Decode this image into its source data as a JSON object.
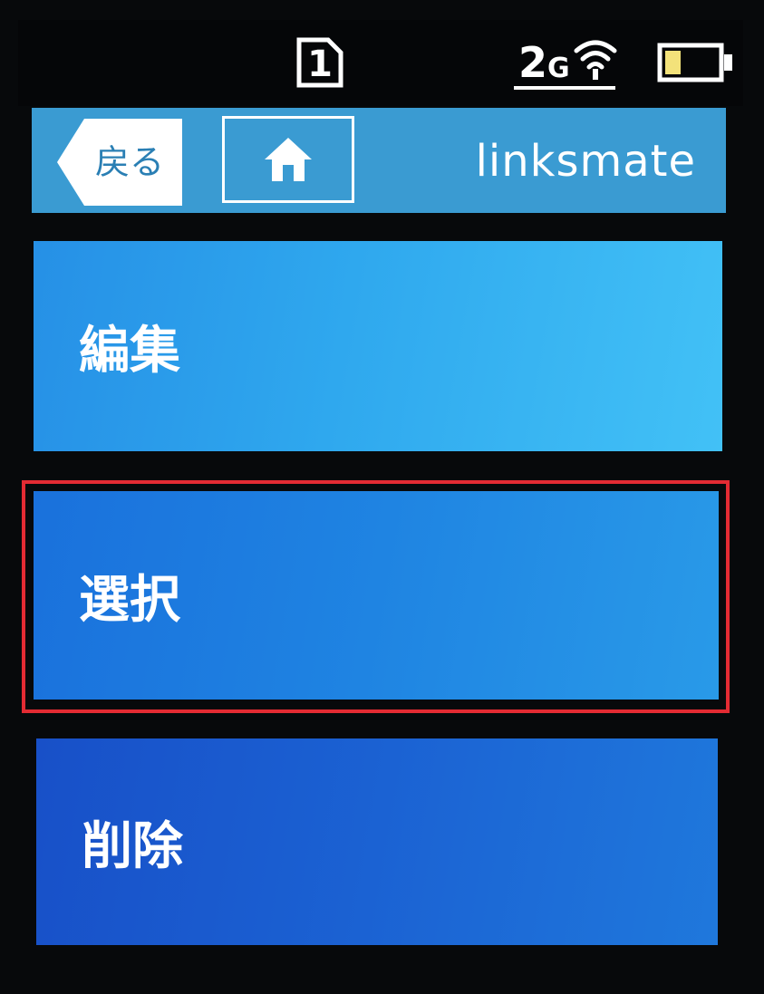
{
  "status_bar": {
    "sim_slot": "1",
    "network_type_number": "2",
    "network_type_letter": "G",
    "icons": [
      "sim-card-icon",
      "wifi-icon",
      "battery-low-icon"
    ],
    "battery_level": 0.3
  },
  "header": {
    "back_label": "戻る",
    "home_icon": "home-icon",
    "carrier": "linksmate"
  },
  "menu": {
    "items": [
      {
        "label": "編集"
      },
      {
        "label": "選択"
      },
      {
        "label": "削除"
      }
    ],
    "highlighted_index": 1
  },
  "colors": {
    "header_bg": "#3a9bd2",
    "item_edit": "#2fa8ee",
    "item_select": "#1f84e2",
    "item_delete": "#1b62d3",
    "highlight": "#e32b33",
    "battery_fill": "#f3e27a"
  }
}
